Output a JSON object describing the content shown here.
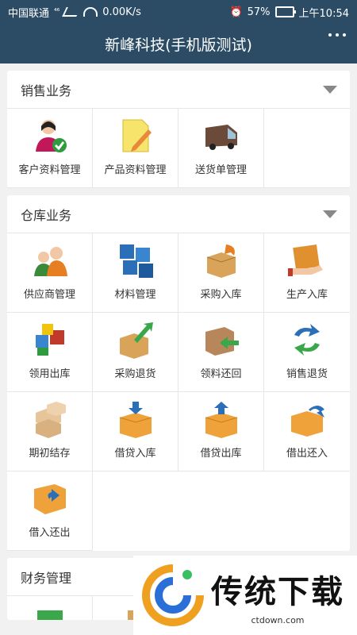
{
  "status_bar": {
    "carrier": "中国联通",
    "net": "⁴⁶",
    "speed": "0.00K/s",
    "battery": "57%",
    "time": "上午10:54"
  },
  "app": {
    "title": "新峰科技(手机版测试)"
  },
  "sections": {
    "sales": {
      "title": "销售业务",
      "items": [
        "客户资料管理",
        "产品资料管理",
        "送货单管理"
      ]
    },
    "warehouse": {
      "title": "仓库业务",
      "items": [
        "供应商管理",
        "材料管理",
        "采购入库",
        "生产入库",
        "领用出库",
        "采购退货",
        "领料还回",
        "销售退货",
        "期初结存",
        "借贷入库",
        "借贷出库",
        "借出还入",
        "借入还出"
      ]
    },
    "finance": {
      "title": "财务管理"
    }
  },
  "watermark": {
    "brand": "传统下载",
    "url": "ctdown.com"
  },
  "colors": {
    "header": "#2b4c64",
    "background": "#f1f1f1"
  }
}
